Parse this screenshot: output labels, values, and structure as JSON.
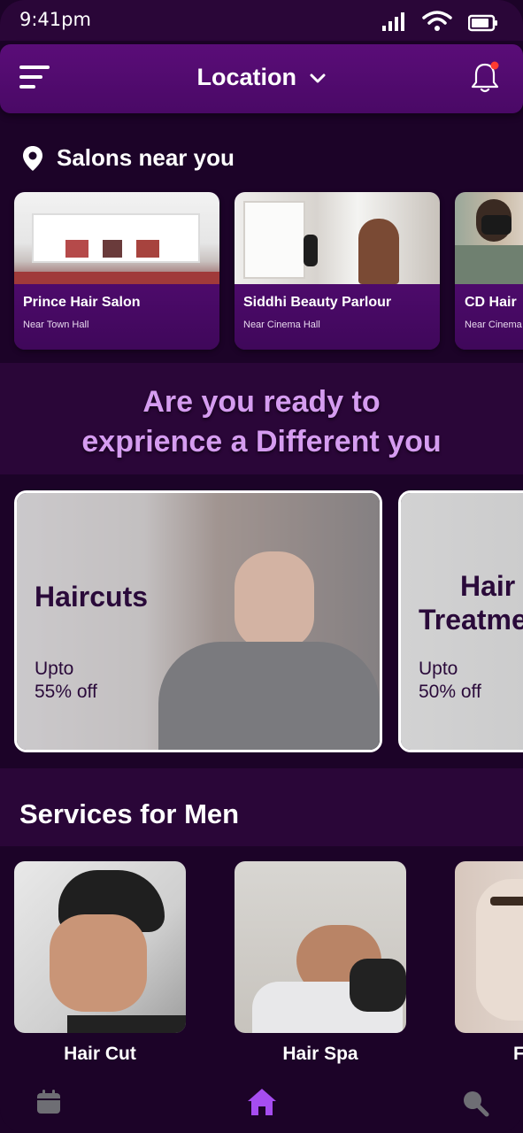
{
  "status_bar": {
    "time": "9:41pm"
  },
  "header": {
    "location_label": "Location",
    "has_notification": true
  },
  "salons": {
    "heading": "Salons near you",
    "items": [
      {
        "name": "Prince Hair Salon",
        "location": "Near Town Hall"
      },
      {
        "name": "Siddhi Beauty Parlour",
        "location": "Near Cinema Hall"
      },
      {
        "name": "CD Hair",
        "location": "Near Cinema"
      }
    ]
  },
  "tagline": {
    "line1": "Are you ready to",
    "line2": "exprience a Different you"
  },
  "offers": {
    "items": [
      {
        "title": "Haircuts",
        "sub_line1": "Upto",
        "sub_line2": "55% off"
      },
      {
        "title_line1": "Hair",
        "title_line2": "Treatme",
        "sub_line1": "Upto",
        "sub_line2": "50% off"
      }
    ]
  },
  "services": {
    "heading": "Services for Men",
    "items": [
      {
        "label": "Hair Cut"
      },
      {
        "label": "Hair Spa"
      },
      {
        "label": "F"
      }
    ]
  },
  "nav": {
    "active": "home"
  },
  "colors": {
    "background": "#1c0328",
    "band": "#2a0638",
    "header": "#5a0d78",
    "card_info": "#4a0966",
    "tagline": "#d59cf0",
    "nav_active": "#a64df0",
    "notification_dot": "#ff3b30"
  },
  "icons": [
    "menu-icon",
    "chevron-down-icon",
    "bell-icon",
    "location-pin-icon",
    "calendar-icon",
    "home-icon",
    "search-icon",
    "signal-icon",
    "wifi-icon",
    "battery-icon"
  ]
}
